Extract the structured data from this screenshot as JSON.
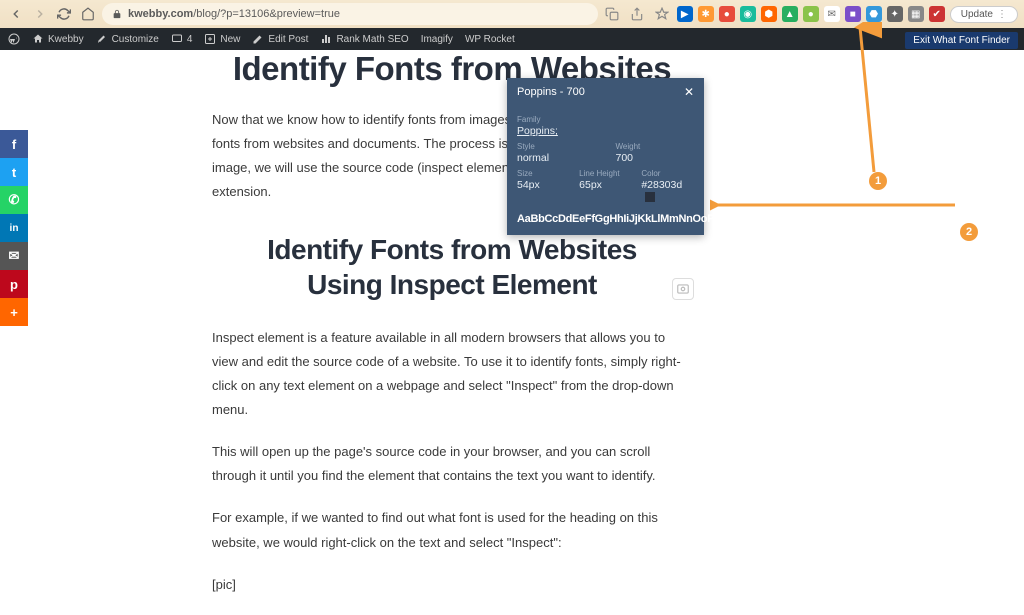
{
  "browser": {
    "url_domain": "kwebby.com",
    "url_path": "/blog/?p=13106&preview=true",
    "update_label": "Update"
  },
  "extensions": [
    {
      "bg": "#0066cc",
      "glyph": "▶"
    },
    {
      "bg": "#ff9933",
      "glyph": "✱"
    },
    {
      "bg": "#e74c3c",
      "glyph": "●"
    },
    {
      "bg": "#1abc9c",
      "glyph": "◉"
    },
    {
      "bg": "#ff6600",
      "glyph": "⬢"
    },
    {
      "bg": "#27ae60",
      "glyph": "▲"
    },
    {
      "bg": "#8bc34a",
      "glyph": "●"
    },
    {
      "bg": "#ffffff",
      "glyph": "✉"
    },
    {
      "bg": "#7b4fc9",
      "glyph": "■"
    },
    {
      "bg": "#3498db",
      "glyph": "⬣"
    },
    {
      "bg": "#666666",
      "glyph": "✦"
    },
    {
      "bg": "#888888",
      "glyph": "▦"
    },
    {
      "bg": "#cc3333",
      "glyph": "✔"
    }
  ],
  "wp_bar": {
    "site": "Kwebby",
    "customize": "Customize",
    "count": "4",
    "new": "New",
    "edit": "Edit Post",
    "rankmath": "Rank Math SEO",
    "imagify": "Imagify",
    "wprocket": "WP Rocket"
  },
  "exit_label": "Exit What Font Finder",
  "social": [
    {
      "name": "facebook",
      "bg": "#3b5998",
      "glyph": "f"
    },
    {
      "name": "twitter",
      "bg": "#1da1f2",
      "glyph": "t"
    },
    {
      "name": "whatsapp",
      "bg": "#25d366",
      "glyph": "✆"
    },
    {
      "name": "linkedin",
      "bg": "#0077b5",
      "glyph": "in"
    },
    {
      "name": "email",
      "bg": "#555555",
      "glyph": "✉"
    },
    {
      "name": "pinterest",
      "bg": "#bd081c",
      "glyph": "p"
    },
    {
      "name": "more",
      "bg": "#ff6600",
      "glyph": "+"
    }
  ],
  "content": {
    "h1": "Identify Fonts from Websites",
    "p1": "Now that we know how to identify fonts from images, let's look at how to identify fonts from websites and documents. The process is similar – instead of using an image, we will use the source code (inspect element) of the webpage or a chrome extension.",
    "h2_line1": "Identify Fonts from",
    "h2_line2_a": "Websites",
    "h2_line3": "Using Inspect Element",
    "p2": "Inspect element is a feature available in all modern browsers that allows you to view and edit the source code of a website. To use it to identify fonts, simply right-click on any text element on a webpage and select \"Inspect\" from the drop-down menu.",
    "p3": "This will open up the page's source code in your browser, and you can scroll through it until you find the element that contains the text you want to identify.",
    "p4": "For example, if we wanted to find out what font is used for the heading on this website, we would right-click on the text and select \"Inspect\":",
    "pic": "[pic]"
  },
  "font_popup": {
    "title": "Poppins - 700",
    "labels": {
      "family": "Family",
      "style": "Style",
      "weight": "Weight",
      "size": "Size",
      "lineheight": "Line Height",
      "color": "Color"
    },
    "values": {
      "family": "Poppins;",
      "style": "normal",
      "weight": "700",
      "size": "54px",
      "lineheight": "65px",
      "color": "#28303d"
    },
    "sample": "AaBbCcDdEeFfGgHhIiJjKkLlMmNnOoP"
  },
  "annotations": {
    "num1": "1",
    "num2": "2"
  }
}
